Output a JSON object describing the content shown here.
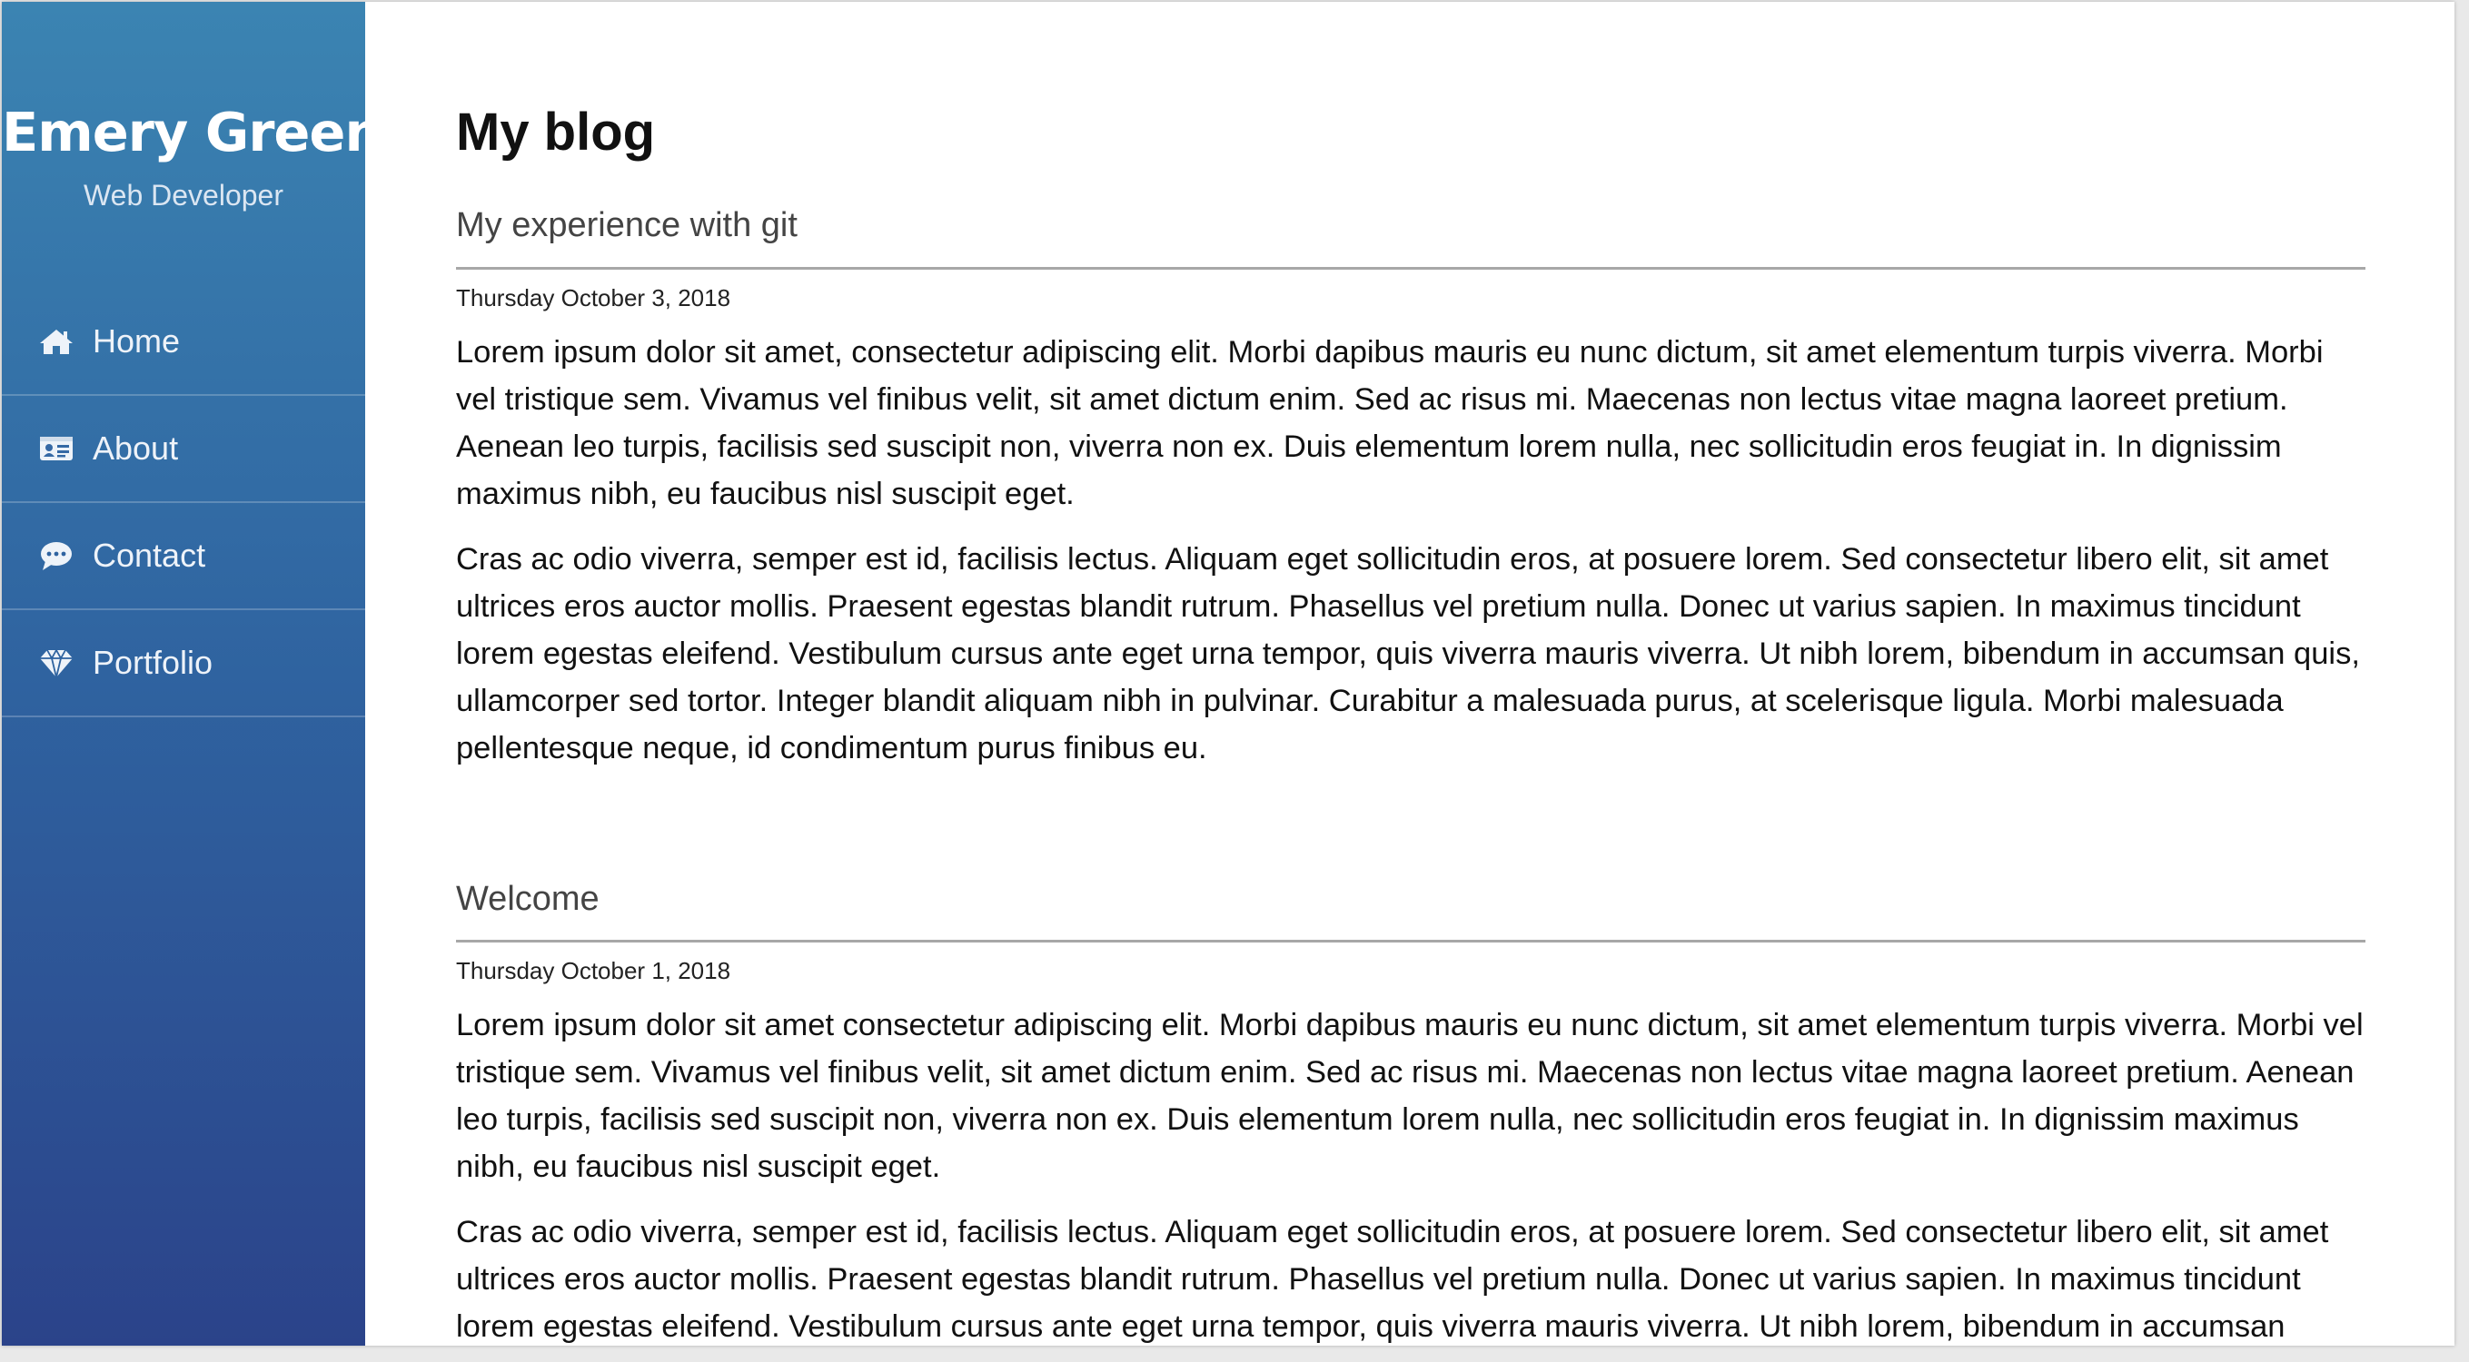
{
  "sidebar": {
    "name": "Emery Green",
    "role": "Web Developer",
    "items": [
      {
        "label": "Home",
        "icon": "home-icon"
      },
      {
        "label": "About",
        "icon": "id-card-icon"
      },
      {
        "label": "Contact",
        "icon": "comment-icon"
      },
      {
        "label": "Portfolio",
        "icon": "diamond-icon"
      }
    ]
  },
  "main": {
    "title": "My blog",
    "posts": [
      {
        "title": "My experience with git",
        "date": "Thursday October 3, 2018",
        "paragraphs": [
          "Lorem ipsum dolor sit amet, consectetur adipiscing elit. Morbi dapibus mauris eu nunc dictum, sit amet elementum turpis viverra. Morbi vel tristique sem. Vivamus vel finibus velit, sit amet dictum enim. Sed ac risus mi. Maecenas non lectus vitae magna laoreet pretium. Aenean leo turpis, facilisis sed suscipit non, viverra non ex. Duis elementum lorem nulla, nec sollicitudin eros feugiat in. In dignissim maximus nibh, eu faucibus nisl suscipit eget.",
          "Cras ac odio viverra, semper est id, facilisis lectus. Aliquam eget sollicitudin eros, at posuere lorem. Sed consectetur libero elit, sit amet ultrices eros auctor mollis. Praesent egestas blandit rutrum. Phasellus vel pretium nulla. Donec ut varius sapien. In maximus tincidunt lorem egestas eleifend. Vestibulum cursus ante eget urna tempor, quis viverra mauris viverra. Ut nibh lorem, bibendum in accumsan quis, ullamcorper sed tortor. Integer blandit aliquam nibh in pulvinar. Curabitur a malesuada purus, at scelerisque ligula. Morbi malesuada pellentesque neque, id condimentum purus finibus eu."
        ]
      },
      {
        "title": "Welcome",
        "date": "Thursday October 1, 2018",
        "paragraphs": [
          "Lorem ipsum dolor sit amet consectetur adipiscing elit. Morbi dapibus mauris eu nunc dictum, sit amet elementum turpis viverra. Morbi vel tristique sem. Vivamus vel finibus velit, sit amet dictum enim. Sed ac risus mi. Maecenas non lectus vitae magna laoreet pretium. Aenean leo turpis, facilisis sed suscipit non, viverra non ex. Duis elementum lorem nulla, nec sollicitudin eros feugiat in. In dignissim maximus nibh, eu faucibus nisl suscipit eget.",
          "Cras ac odio viverra, semper est id, facilisis lectus. Aliquam eget sollicitudin eros, at posuere lorem. Sed consectetur libero elit, sit amet ultrices eros auctor mollis. Praesent egestas blandit rutrum. Phasellus vel pretium nulla. Donec ut varius sapien. In maximus tincidunt lorem egestas eleifend. Vestibulum cursus ante eget urna tempor, quis viverra mauris viverra. Ut nibh lorem, bibendum in accumsan"
        ]
      }
    ]
  },
  "colors": {
    "sidebar_top": "#3b84b2",
    "sidebar_bottom": "#2b438a",
    "divider": "#a7a7a7"
  }
}
